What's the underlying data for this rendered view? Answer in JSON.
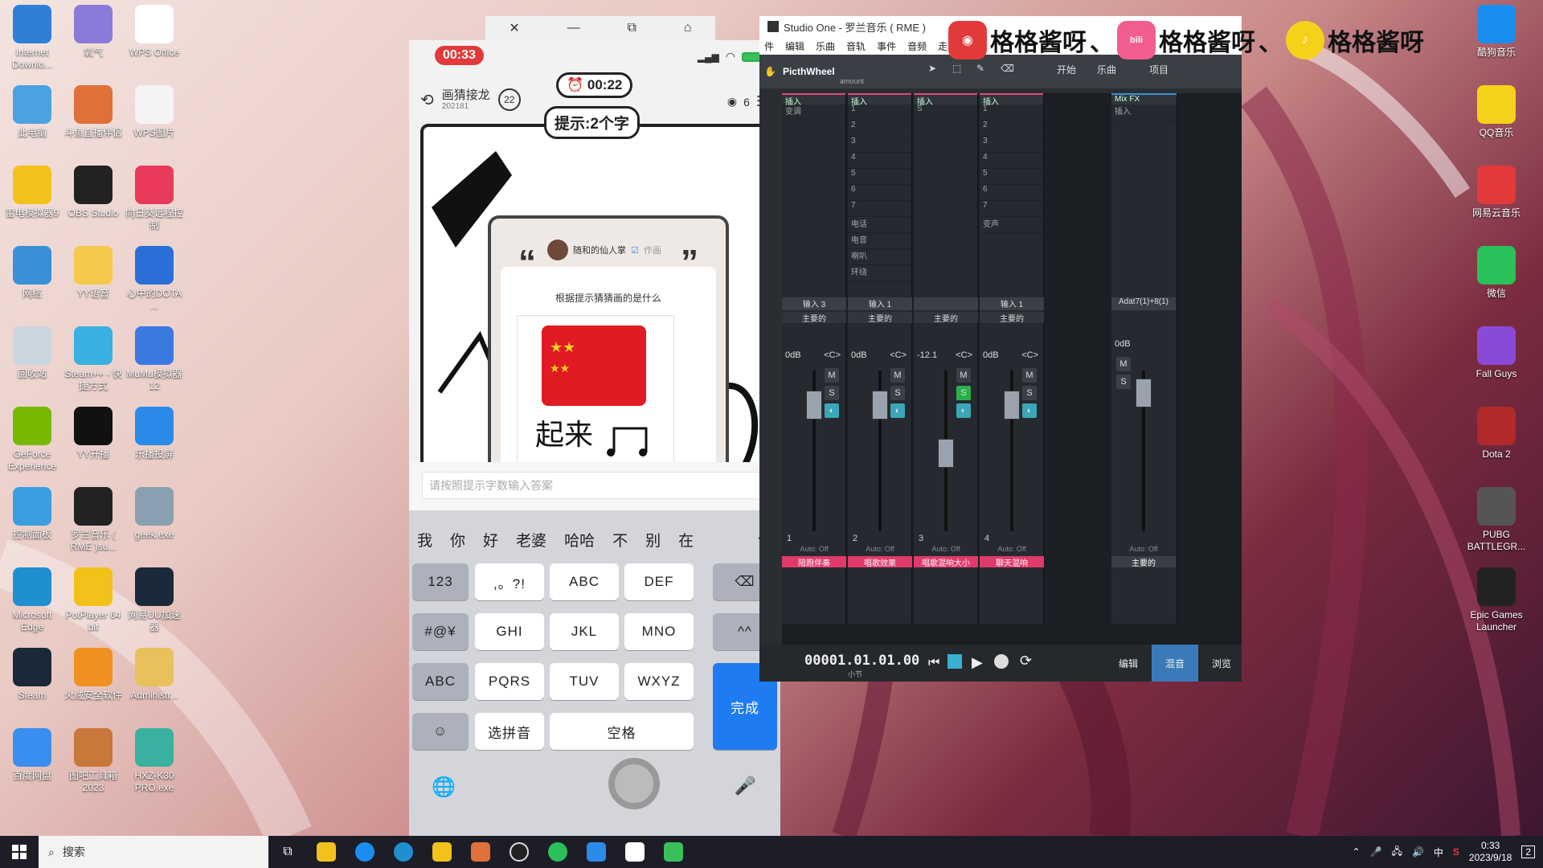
{
  "desktop_left": [
    {
      "label": "Internet Downlo...",
      "color": "#2f7fd8"
    },
    {
      "label": "氧气",
      "color": "#8a7bd8"
    },
    {
      "label": "WPS Office",
      "color": "#ffffff"
    },
    {
      "label": "此电脑",
      "color": "#4aa3e0"
    },
    {
      "label": "斗鱼直播伴侣",
      "color": "#e0703a"
    },
    {
      "label": "WPS图片",
      "color": "#f4f4f4"
    },
    {
      "label": "雷电模拟器9",
      "color": "#f2c21a"
    },
    {
      "label": "OBS Studio",
      "color": "#222222"
    },
    {
      "label": "向日葵远程控制",
      "color": "#e83a5a"
    },
    {
      "label": "网络",
      "color": "#3a8fd8"
    },
    {
      "label": "YY语音",
      "color": "#f5c94a"
    },
    {
      "label": "心中的DOTA ...",
      "color": "#2a6fd8"
    },
    {
      "label": "回收站",
      "color": "#c9d6e0"
    },
    {
      "label": "Steam++ - 快捷方式",
      "color": "#3ab0e0"
    },
    {
      "label": "MuMu模拟器12",
      "color": "#3a7ae0"
    },
    {
      "label": "GeForce Experience",
      "color": "#76b900"
    },
    {
      "label": "YY开播",
      "color": "#111111"
    },
    {
      "label": "乐播投屏",
      "color": "#2a8be8"
    },
    {
      "label": "控制面板",
      "color": "#3a9ee0"
    },
    {
      "label": "罗兰音乐 ( RME )su...",
      "color": "#222222"
    },
    {
      "label": "geek.exe",
      "color": "#8aa0b0"
    },
    {
      "label": "Microsoft Edge",
      "color": "#1f8fd0"
    },
    {
      "label": "PotPlayer 64 bit",
      "color": "#f2c21a"
    },
    {
      "label": "网易UU加速器",
      "color": "#1a2a3a"
    },
    {
      "label": "Steam",
      "color": "#1b2838"
    },
    {
      "label": "火绒安全软件",
      "color": "#f09020"
    },
    {
      "label": "Administr...",
      "color": "#e8c15a"
    },
    {
      "label": "百度网盘",
      "color": "#3a8ef0"
    },
    {
      "label": "图吧工具箱2023",
      "color": "#c8783a"
    },
    {
      "label": "HXZ-K30 PRO.exe",
      "color": "#3ab0a0"
    }
  ],
  "desktop_right": [
    {
      "label": "酷狗音乐",
      "color": "#1a8ef0"
    },
    {
      "label": "QQ音乐",
      "color": "#f5d21a"
    },
    {
      "label": "网易云音乐",
      "color": "#e23a3a"
    },
    {
      "label": "微信",
      "color": "#2ac15a"
    },
    {
      "label": "Fall Guys",
      "color": "#8a4ad8"
    },
    {
      "label": "Dota 2",
      "color": "#b02a2a"
    },
    {
      "label": "PUBG BATTLEGR...",
      "color": "#555555"
    },
    {
      "label": "Epic Games Launcher",
      "color": "#222222"
    }
  ],
  "taskbar": {
    "search_placeholder": "搜索",
    "time": "0:33",
    "date": "2023/9/18",
    "ime": "中",
    "notification_count": "2"
  },
  "phone": {
    "status_time": "00:33",
    "game_title": "画猜接龙",
    "game_sub": "202181",
    "round": "22",
    "timer": "00:22",
    "hint": "提示:2个字",
    "viewers": "6",
    "author": "随和的仙人掌",
    "author_suffix": "作画",
    "card_text": "根据提示猜猜画的是什么",
    "drawing_caption": "起来",
    "answer_placeholder": "请按照提示字数输入答案",
    "candidates": [
      "我",
      "你",
      "好",
      "老婆",
      "哈哈",
      "不",
      "别",
      "在"
    ],
    "keys": {
      "k123": "123",
      "punct": ",。?!",
      "abc": "ABC",
      "def": "DEF",
      "sym": "#@¥",
      "ghi": "GHI",
      "jkl": "JKL",
      "mno": "MNO",
      "caret": "^^",
      "abc2": "ABC",
      "pqrs": "PQRS",
      "tuv": "TUV",
      "wxyz": "WXYZ",
      "done": "完成",
      "pinyin": "选拼音",
      "space": "空格"
    }
  },
  "studio": {
    "title": "Studio One - 罗兰音乐 ( RME )",
    "menu": [
      "件",
      "编辑",
      "乐曲",
      "音轨",
      "事件",
      "音频",
      "走"
    ],
    "plugin": "PicthWheel",
    "preset": "amount",
    "tabs": {
      "start": "开始",
      "song": "乐曲",
      "project": "项目"
    },
    "mixfx": "Mix FX",
    "insert": "插入",
    "strips": [
      {
        "input": "输入 3",
        "bus": "主要的",
        "vol": "0dB",
        "pan": "<C>",
        "num": "1",
        "label": "陪跑伴奏",
        "slots": [
          "变调"
        ]
      },
      {
        "input": "输入 1",
        "bus": "主要的",
        "vol": "0dB",
        "pan": "<C>",
        "num": "2",
        "label": "唱歌效果",
        "slots": [
          "1",
          "2",
          "3",
          "4",
          "5",
          "6",
          "7",
          "电话",
          "电音",
          "喇叭",
          "环绕"
        ]
      },
      {
        "input": "",
        "bus": "主要的",
        "vol": "-12.1",
        "pan": "<C>",
        "num": "3",
        "label": "唱歌混响大小",
        "slots": [
          "S"
        ]
      },
      {
        "input": "输入 1",
        "bus": "主要的",
        "vol": "0dB",
        "pan": "<C>",
        "num": "4",
        "label": "聊天混响",
        "slots": [
          "1",
          "2",
          "3",
          "4",
          "5",
          "6",
          "7",
          "变声"
        ]
      }
    ],
    "master": {
      "input": "Adat7(1)+8(1)",
      "vol": "0dB",
      "label": "主要的"
    },
    "auto_off": "Auto: Off",
    "transport_time": "00001.01.01.00",
    "transport_sub": "小节",
    "bottom_tabs": [
      "编辑",
      "混音",
      "浏览"
    ]
  },
  "banner": {
    "text": "格格酱呀",
    "sep": "、",
    "logos": [
      "网易云",
      "bilibili",
      "QQ音乐"
    ]
  }
}
